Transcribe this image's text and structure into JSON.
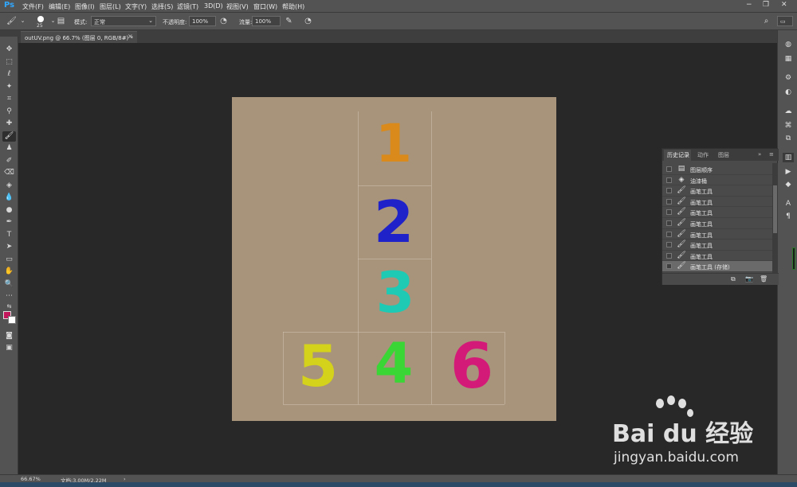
{
  "app": {
    "logo": "Ps",
    "menus": [
      "文件(F)",
      "编辑(E)",
      "图像(I)",
      "图层(L)",
      "文字(Y)",
      "选择(S)",
      "滤镜(T)",
      "3D(D)",
      "视图(V)",
      "窗口(W)",
      "帮助(H)"
    ]
  },
  "options": {
    "brush_size": "25",
    "mode_label": "模式:",
    "mode_value": "正常",
    "opacity_label": "不透明度:",
    "opacity_value": "100%",
    "flow_label": "流量:",
    "flow_value": "100%"
  },
  "document": {
    "tab_title": "outUV.png @ 66.7% (图层 0, RGB/8#) *",
    "close_glyph": "×"
  },
  "canvas": {
    "background": "#a8947a",
    "digits": [
      {
        "text": "1",
        "color": "#d98a1a"
      },
      {
        "text": "2",
        "color": "#1e22c8"
      },
      {
        "text": "3",
        "color": "#1ecab4"
      },
      {
        "text": "5",
        "color": "#d4d21a"
      },
      {
        "text": "4",
        "color": "#3ad636"
      },
      {
        "text": "6",
        "color": "#d41a78"
      }
    ]
  },
  "history_panel": {
    "tabs": [
      "历史记录",
      "动作",
      "图层"
    ],
    "rows": [
      {
        "icon": "document-icon",
        "label": "图层顺序"
      },
      {
        "icon": "paint-bucket-icon",
        "label": "油漆桶"
      },
      {
        "icon": "brush-icon",
        "label": "画笔工具"
      },
      {
        "icon": "brush-icon",
        "label": "画笔工具"
      },
      {
        "icon": "brush-icon",
        "label": "画笔工具"
      },
      {
        "icon": "brush-icon",
        "label": "画笔工具"
      },
      {
        "icon": "brush-icon",
        "label": "画笔工具"
      },
      {
        "icon": "brush-icon",
        "label": "画笔工具"
      },
      {
        "icon": "brush-icon",
        "label": "画笔工具"
      },
      {
        "icon": "brush-icon",
        "label": "画笔工具 (存储)"
      }
    ]
  },
  "colors": {
    "foreground": "#c2185b",
    "background": "#ffffff"
  },
  "status": {
    "zoom": "66.67%",
    "doc_size": "文档:3.00M/2.22M"
  },
  "watermark": {
    "logo": "Bai du 经验",
    "url": "jingyan.baidu.com"
  }
}
